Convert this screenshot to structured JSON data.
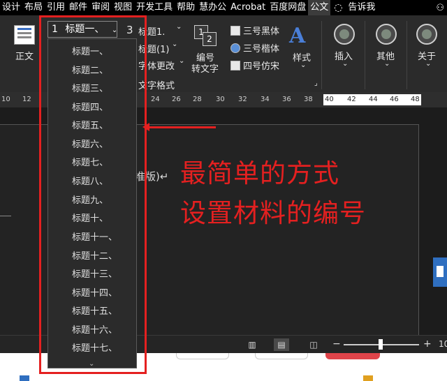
{
  "menu_tabs": [
    "设计",
    "布局",
    "引用",
    "邮件",
    "审阅",
    "视图",
    "开发工具",
    "帮助",
    "慧办公",
    "Acrobat",
    "百度网盘",
    "公文"
  ],
  "tell_me": "告诉我",
  "ribbon": {
    "zhengwen": "正文",
    "combo_num": "1",
    "combo_label": "标题一、",
    "combo_arrow": "⌄",
    "h3_num": "3",
    "h3_label": "标题1.",
    "h3_arrow": "⌄",
    "h1paren_label": "标题(1)",
    "h1paren_arrow": "⌄",
    "font_change": "字体更改",
    "font_change_arrow": "⌄",
    "group_label": "文字格式",
    "bianhao_num_a": "1",
    "bianhao_num_b": "2",
    "bianhao_line1": "编号",
    "bianhao_line2": "转文字",
    "font1": "三号黑体",
    "font2": "三号楷体",
    "font3": "四号仿宋",
    "style_letter": "A",
    "style_label": "样式",
    "insert_label": "插入",
    "other_label": "其他",
    "about_label": "关于"
  },
  "ruler_ticks": [
    "10",
    "12",
    "24",
    "26",
    "28",
    "30",
    "32",
    "34",
    "36",
    "38",
    "40",
    "42",
    "44",
    "46",
    "48"
  ],
  "dropdown_items": [
    "标题一、",
    "标题二、",
    "标题三、",
    "标题四、",
    "标题五、",
    "标题六、",
    "标题七、",
    "标题八、",
    "标题九、",
    "标题十、",
    "标题十一、",
    "标题十二、",
    "标题十三、",
    "标题十四、",
    "标题十五、",
    "标题十六、",
    "标题十七、"
  ],
  "document_fragment": "准版)↵",
  "annotation": {
    "line1": "最简单的方式",
    "line2": "设置材料的编号",
    "color": "#e42020"
  },
  "status": {
    "zoom_minus": "−",
    "zoom_plus": "+",
    "zoom_value": "10"
  }
}
